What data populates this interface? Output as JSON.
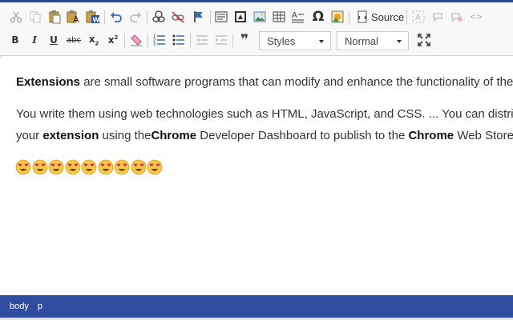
{
  "toolbar": {
    "source_label": "Source",
    "styles_combo": {
      "value": "Styles"
    },
    "format_combo": {
      "value": "Normal"
    },
    "bold_label": "B",
    "italic_label": "I",
    "underline_label": "U",
    "strike_label": "abc",
    "subscript_label": "x",
    "superscript_label": "x",
    "sub_mark": "2",
    "sup_mark": "2",
    "special_char_label": "Ω",
    "quote_label": "❞",
    "code_label": "<>"
  },
  "content": {
    "p1": {
      "bold_start": "Extensions",
      "rest": " are small software programs that can modify and enhance the functionality of the Chrome browser."
    },
    "p2": {
      "line1": "You write them using web technologies such as HTML, JavaScript, and CSS. ... You can distribute",
      "line2_prefix": "your ",
      "line2_bold1": "extension",
      "line2_mid": " using the",
      "line2_bold2": "Chrome",
      "line2_mid2": " Developer Dashboard to publish to the ",
      "line2_bold3": "Chrome",
      "line2_tail": " Web Store."
    },
    "emoji_count": 9,
    "emoji_name": "heart-eyes-emoji"
  },
  "statusbar": {
    "path": [
      "body",
      "p"
    ]
  },
  "colors": {
    "accent": "#2f4c9e",
    "icon_blue": "#3b6bb5",
    "icon_gray": "#555555",
    "emoji_face": "#f7c948",
    "emoji_heart": "#e0245e"
  }
}
